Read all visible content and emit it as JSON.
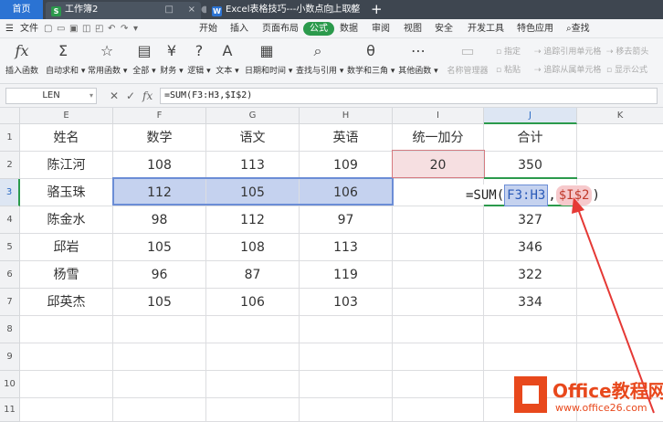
{
  "titlebar": {
    "home_tab": "首页",
    "workbook_tab": "工作簿2",
    "doc_tab": "Excel表格技巧---小数点向上取整",
    "close_glyph": "×",
    "new_tab_glyph": "+"
  },
  "menu": {
    "file": "文件",
    "items": [
      "开始",
      "插入",
      "页面布局",
      "公式",
      "数据",
      "审阅",
      "视图",
      "安全",
      "开发工具",
      "特色应用"
    ],
    "active": "公式",
    "search": "查找"
  },
  "toolbar": {
    "insert_function": "插入函数",
    "autosum": "自动求和",
    "common_functions": "常用函数",
    "all": "全部",
    "financial": "财务",
    "logical": "逻辑",
    "text": "文本",
    "datetime": "日期和时间",
    "lookup": "查找与引用",
    "math": "数学和三角",
    "other": "其他函数",
    "name_manager": "名称管理器",
    "specify": "指定",
    "paste": "粘贴",
    "trace_precedents": "追踪引用单元格",
    "trace_dependents": "追踪从属单元格",
    "remove_arrows": "移去箭头",
    "show_formulas": "显示公式"
  },
  "formula_bar": {
    "name_box": "LEN",
    "cancel_glyph": "✕",
    "confirm_glyph": "✓",
    "fx_glyph": "fx",
    "formula": "=SUM(F3:H3,$I$2)"
  },
  "grid": {
    "columns": [
      "E",
      "F",
      "G",
      "H",
      "I",
      "J",
      "K"
    ],
    "rows": [
      "1",
      "2",
      "3",
      "4",
      "5",
      "6",
      "7",
      "8",
      "9",
      "10",
      "11"
    ],
    "headers": [
      "姓名",
      "数学",
      "语文",
      "英语",
      "统一加分",
      "合计"
    ],
    "data": [
      [
        "陈江河",
        "108",
        "113",
        "109",
        "20",
        "350"
      ],
      [
        "骆玉珠",
        "112",
        "105",
        "106",
        "",
        ""
      ],
      [
        "陈金水",
        "98",
        "112",
        "97",
        "",
        "327"
      ],
      [
        "邱岩",
        "105",
        "108",
        "113",
        "",
        "346"
      ],
      [
        "杨雪",
        "96",
        "87",
        "119",
        "",
        "322"
      ],
      [
        "邱英杰",
        "105",
        "106",
        "103",
        "",
        "334"
      ]
    ],
    "editing_formula": {
      "prefix": "=SUM(",
      "range": "F3:H3",
      "separator": ",",
      "ref": "$I$2",
      "suffix": ")"
    }
  },
  "colors": {
    "accent_green": "#2b9a4c",
    "range_fill": "#c5d2ef",
    "ref_fill": "#f6dfe1",
    "arrow_red": "#e53935"
  },
  "logo": {
    "line1": "Office教程网",
    "line2": "www.office26.com"
  }
}
